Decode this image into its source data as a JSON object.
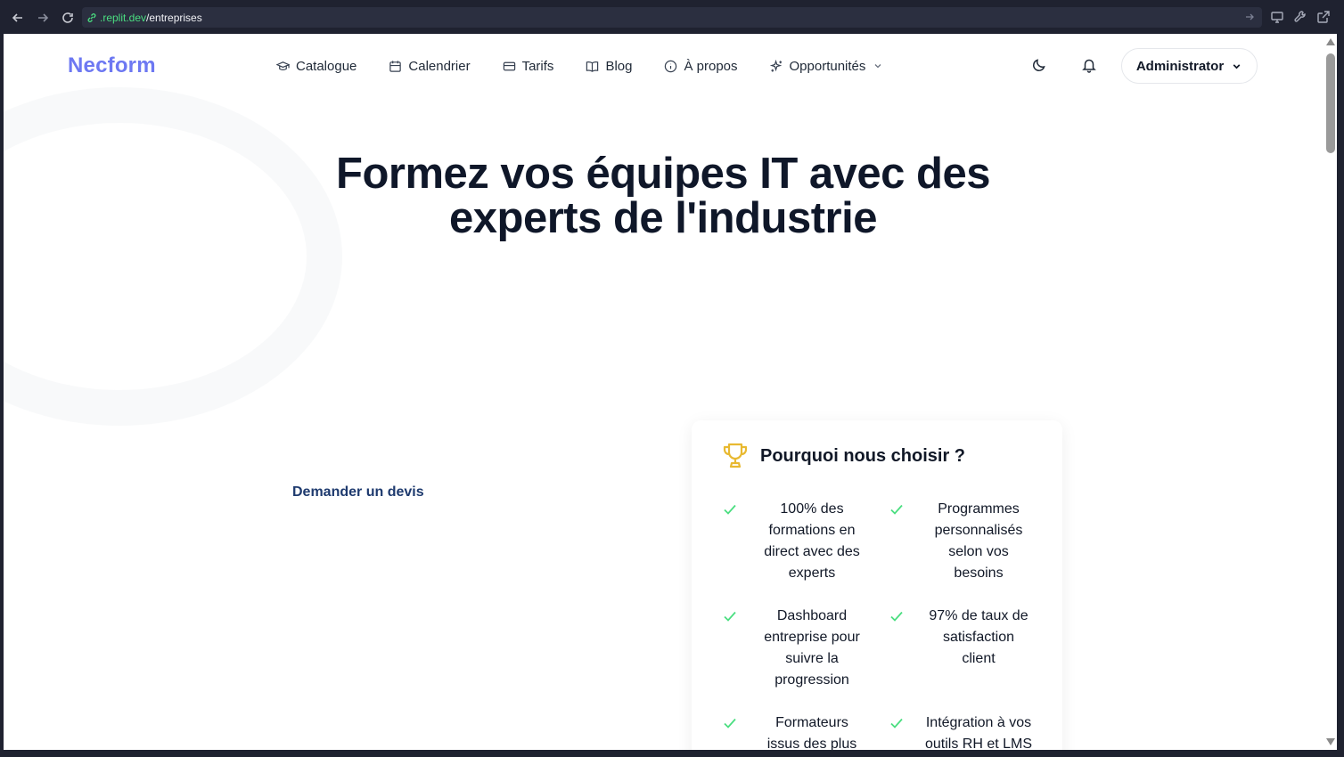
{
  "browser": {
    "url_domain": ".replit.dev",
    "url_path": "/entreprises"
  },
  "header": {
    "logo": "Necform",
    "menu": [
      {
        "label": "Catalogue",
        "icon": "graduation-cap-icon"
      },
      {
        "label": "Calendrier",
        "icon": "calendar-icon"
      },
      {
        "label": "Tarifs",
        "icon": "credit-card-icon"
      },
      {
        "label": "Blog",
        "icon": "book-open-icon"
      },
      {
        "label": "À propos",
        "icon": "info-icon"
      },
      {
        "label": "Opportunités",
        "icon": "sparkles-icon"
      }
    ],
    "user_label": "Administrator"
  },
  "hero": {
    "title_line1": "Formez vos équipes IT avec des",
    "title_line2": "experts de l'industrie",
    "quote_link": "Demander un devis"
  },
  "why_card": {
    "title": "Pourquoi nous choisir ?",
    "features": [
      [
        "100% des",
        "formations en",
        "direct avec des",
        "experts"
      ],
      [
        "Programmes",
        "personnalisés",
        "selon vos",
        "besoins"
      ],
      [
        "Dashboard",
        "entreprise pour",
        "suivre la",
        "progression"
      ],
      [
        "97% de taux de",
        "satisfaction",
        "client"
      ],
      [
        "Formateurs",
        "issus des plus"
      ],
      [
        "Intégration à vos",
        "outils RH et LMS"
      ]
    ]
  },
  "colors": {
    "logo": "#6d78f2",
    "check": "#4ade80",
    "trophy": "#e8b931",
    "title": "#0f1729",
    "link": "#1e3a6e"
  }
}
